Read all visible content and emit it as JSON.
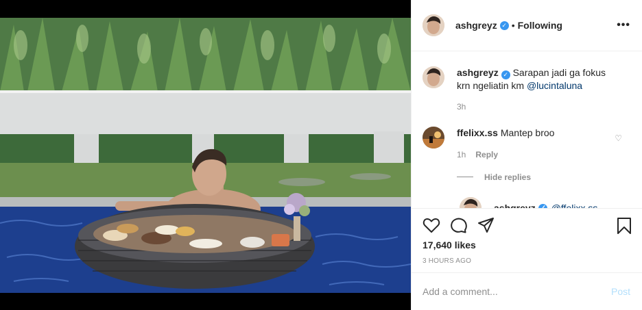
{
  "post": {
    "author": "ashgreyz",
    "follow_state": "Following",
    "separator": "•",
    "more_label": "•••"
  },
  "caption": {
    "username": "ashgreyz",
    "text": "Sarapan jadi ga fokus krn ngeliatin km ",
    "mention": "@lucintaluna",
    "time": "3h"
  },
  "comments": [
    {
      "username": "ffelixx.ss",
      "text": "Mantep broo",
      "time": "1h",
      "reply_label": "Reply"
    }
  ],
  "hide_replies_label": "Hide replies",
  "reply_preview": {
    "username": "ashgreyz",
    "mention": "@ffelixx.ss"
  },
  "stats": {
    "likes": "17,640 likes",
    "posted": "3 HOURS AGO"
  },
  "composer": {
    "placeholder": "Add a comment...",
    "post_label": "Post"
  },
  "colors": {
    "verified": "#3897f0",
    "mention": "#00376b",
    "muted": "#8e8e8e",
    "post_disabled": "#b2dffc"
  },
  "icons": [
    "heart-icon",
    "comment-icon",
    "share-icon",
    "bookmark-icon",
    "verified-icon",
    "more-icon",
    "small-heart-icon"
  ]
}
